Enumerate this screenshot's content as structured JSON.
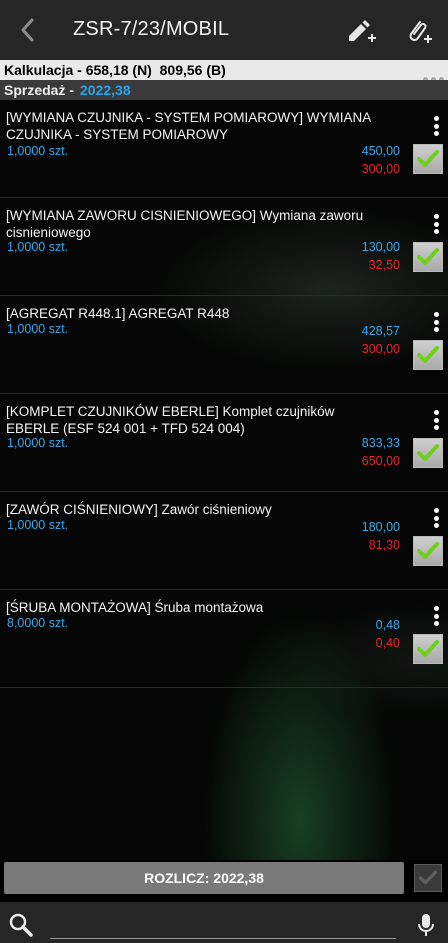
{
  "header": {
    "title": "ZSR-7/23/MOBIL",
    "back_icon": "chevron-left-icon",
    "actions": [
      "edit-add-icon",
      "attachment-add-icon"
    ]
  },
  "summary": {
    "calc_label": "Kalkulacja - 658,18 (N)  809,56 (B)",
    "sale_label": "Sprzedaż -",
    "sale_value": "2022,38"
  },
  "items": [
    {
      "name": "[WYMIANA CZUJNIKA - SYSTEM POMIAROWY] WYMIANA CZUJNIKA - SYSTEM POMIAROWY",
      "qty": "1,0000 szt.",
      "price": "450,00",
      "cost": "300,00",
      "checked": true
    },
    {
      "name": "[WYMIANA ZAWORU CISNIENIOWEGO] Wymiana zaworu cisnieniowego",
      "qty": "1,0000 szt.",
      "price": "130,00",
      "cost": "32,50",
      "checked": true
    },
    {
      "name": "[AGREGAT R448.1] AGREGAT R448",
      "qty": "1,0000 szt.",
      "price": "428,57",
      "cost": "300,00",
      "checked": true
    },
    {
      "name": "[KOMPLET CZUJNIKÓW EBERLE] Komplet czujników EBERLE (ESF 524 001 + TFD 524 004)",
      "qty": "1,0000 szt.",
      "price": "833,33",
      "cost": "650,00",
      "checked": true
    },
    {
      "name": "[ZAWÓR CIŚNIENIOWY] Zawór ciśnieniowy",
      "qty": "1,0000 szt.",
      "price": "180,00",
      "cost": "81,30",
      "checked": true
    },
    {
      "name": "[ŚRUBA MONTAŻOWA] Śruba montażowa",
      "qty": "8,0000 szt.",
      "price": "0,48",
      "cost": "0,40",
      "checked": true
    }
  ],
  "footer": {
    "settle_label": "ROZLICZ: 2022,38",
    "search_placeholder": "",
    "search_icon": "search-icon",
    "mic_icon": "microphone-icon"
  },
  "colors": {
    "accent_blue": "#29a3e6",
    "cost_red": "#e8262c",
    "check_green": "#6fcf1f"
  }
}
